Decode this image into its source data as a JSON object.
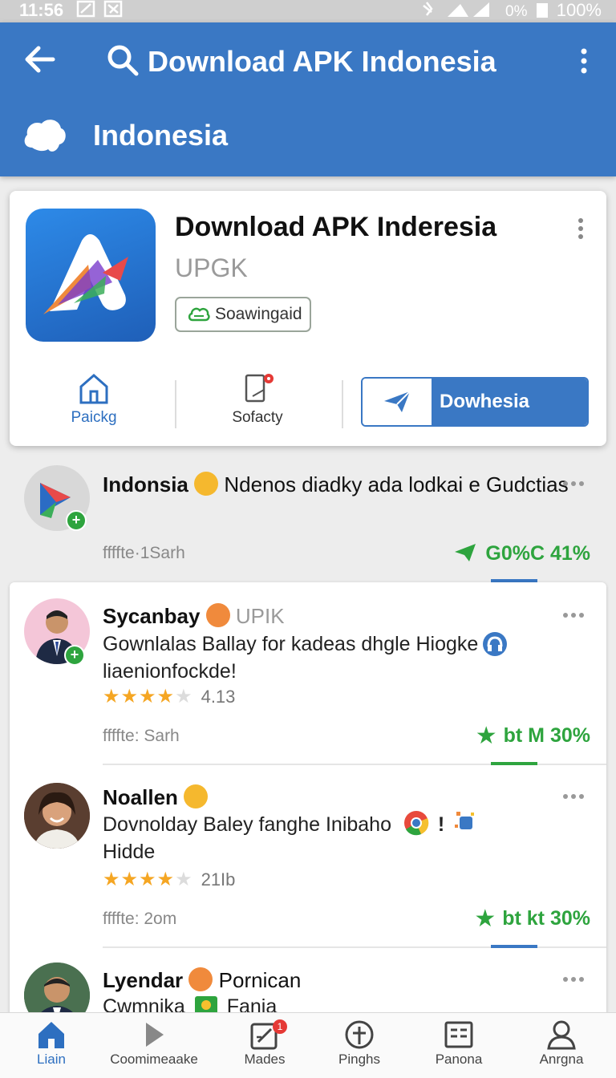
{
  "status_bar": {
    "time": "11:56",
    "battery_text": "0%",
    "battery_pct": "100%"
  },
  "app_bar": {
    "title": "Download APK Indonesia",
    "subtitle": "Indonesia"
  },
  "app_card": {
    "name": "Download APK Inderesia",
    "developer": "UPGK",
    "tag": "Soawingaid",
    "actions": {
      "package": "Paickg",
      "safety": "Sofacty",
      "download": "Dowhesia"
    }
  },
  "reviews": [
    {
      "name": "Indonsia",
      "dev": "",
      "text": "Ndenos diadky ada lodkai e Gudctias",
      "meta": "ffffte·1Sarh",
      "stat": "G0%C 41%",
      "rating": null,
      "rating_text": ""
    },
    {
      "name": "Sycanbay",
      "dev": "UPIK",
      "text": "Gownlalas Ballay for kadeas dhgle Hiogke liaenionfockde!",
      "meta": "ffffte: Sarh",
      "stat": "bt M 30%",
      "rating": 4,
      "rating_text": "4.13"
    },
    {
      "name": "Noallen",
      "dev": "",
      "text": "Dovnolday Baley fanghe Inibaho",
      "text2": "Hidde",
      "meta": "ffffte: 2om",
      "stat": "bt kt 30%",
      "rating": 4,
      "rating_text": "21Ib"
    },
    {
      "name": "Lyendar",
      "dev": "Pornican",
      "text": "Cwmnika",
      "text_after": "Fania"
    }
  ],
  "bottom_nav": [
    {
      "label": "Liain",
      "icon": "home-icon",
      "active": true
    },
    {
      "label": "Coomimeaake",
      "icon": "play-icon"
    },
    {
      "label": "Mades",
      "icon": "edit-icon",
      "badge": "1"
    },
    {
      "label": "Pinghs",
      "icon": "pin-icon"
    },
    {
      "label": "Panona",
      "icon": "list-icon"
    },
    {
      "label": "Anrgna",
      "icon": "person-icon"
    }
  ],
  "colors": {
    "primary": "#3a78c4",
    "positive": "#2ea43e",
    "star": "#f5a623"
  }
}
